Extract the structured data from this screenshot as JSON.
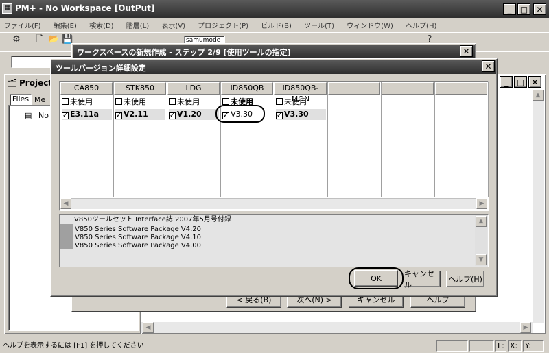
{
  "app": {
    "title": "PM+ - No Workspace  [OutPut]",
    "menu": [
      "ファイル(F)",
      "編集(E)",
      "検索(D)",
      "階層(L)",
      "表示(V)",
      "プロジェクト(P)",
      "ビルド(B)",
      "ツール(T)",
      "ウィンドウ(W)",
      "ヘルプ(H)"
    ],
    "toolbar_combo": "samumode",
    "status_text": "ヘルプを表示するには [F1] を押してください",
    "status_l": "L:",
    "status_x": "X:",
    "status_y": "Y:"
  },
  "project_panel": {
    "title": "Project",
    "tab_files": "Files",
    "tab_mem": "Me",
    "tree_item": "No"
  },
  "wizard": {
    "title": "ワークスペースの新規作成 - ステップ 2/9 [使用ツールの指定]",
    "back_label": "< 戻る(B)",
    "next_label": "次へ(N) >",
    "cancel_label": "キャンセル",
    "help_label": "ヘルプ"
  },
  "dialog": {
    "title": "ツールバージョン詳細設定",
    "columns": [
      {
        "header": "CA850",
        "rows": [
          {
            "label": "未使用",
            "checked": false,
            "bold": false,
            "selected": false
          },
          {
            "label": "E3.11a",
            "checked": true,
            "bold": true,
            "selected": true
          }
        ]
      },
      {
        "header": "STK850",
        "rows": [
          {
            "label": "未使用",
            "checked": false,
            "bold": false,
            "selected": false
          },
          {
            "label": "V2.11",
            "checked": true,
            "bold": true,
            "selected": true
          }
        ]
      },
      {
        "header": "LDG",
        "rows": [
          {
            "label": "未使用",
            "checked": false,
            "bold": false,
            "selected": false
          },
          {
            "label": "V1.20",
            "checked": true,
            "bold": true,
            "selected": true
          }
        ]
      },
      {
        "header": "ID850QB",
        "rows": [
          {
            "label": "未使用",
            "checked": false,
            "bold": true,
            "selected": false
          },
          {
            "label": "V3.30",
            "checked": true,
            "bold": false,
            "selected": false
          }
        ]
      },
      {
        "header": "ID850QB-MON",
        "rows": [
          {
            "label": "未使用",
            "checked": false,
            "bold": false,
            "selected": false
          },
          {
            "label": "V3.30",
            "checked": true,
            "bold": true,
            "selected": true
          }
        ]
      },
      {
        "header": "",
        "rows": []
      },
      {
        "header": "",
        "rows": []
      },
      {
        "header": "",
        "rows": []
      }
    ],
    "info_lines": [
      "V850ツールセット Interface誌 2007年5月号付録",
      "V850 Series Software Package V4.20",
      "V850 Series Software Package V4.10",
      "V850 Series Software Package V4.00"
    ],
    "ok_label": "OK",
    "cancel_label": "キャンセル",
    "help_label": "ヘルプ(H)"
  },
  "colors": {
    "titlebar": "#3c3c3c",
    "face": "#d4d0c8",
    "highlight_circle": "#000000"
  }
}
